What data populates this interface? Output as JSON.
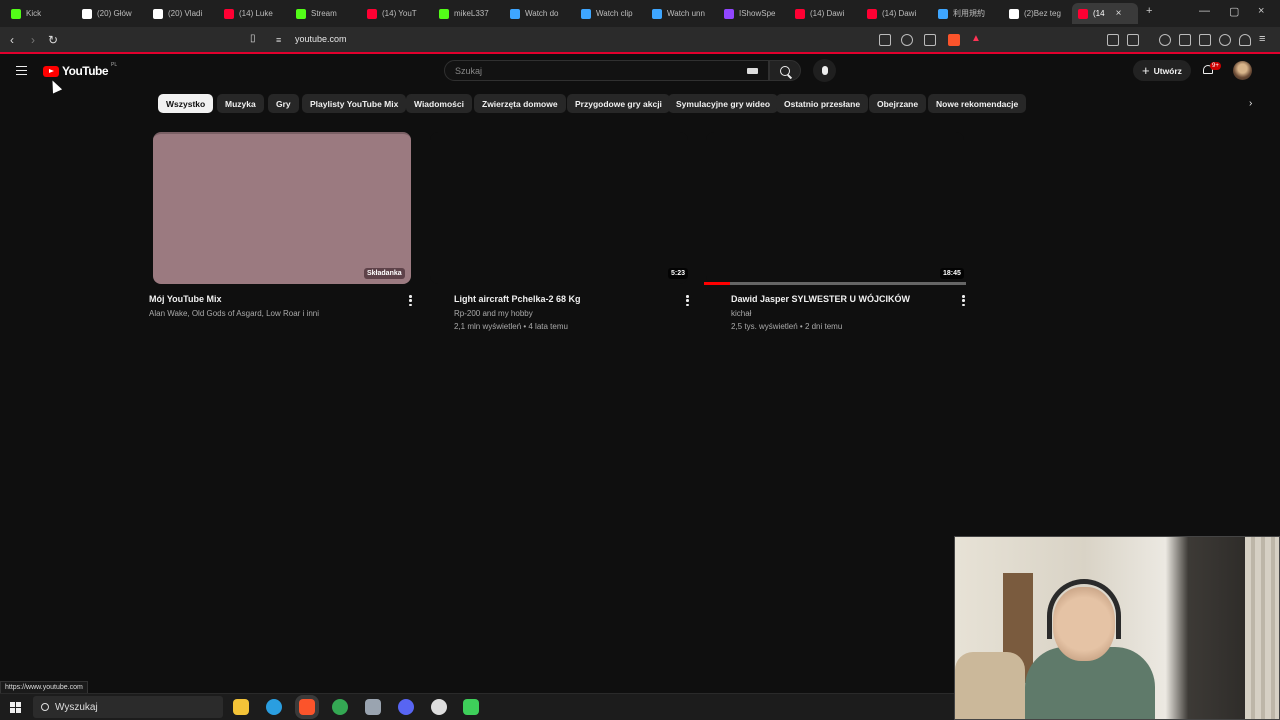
{
  "browser": {
    "tabs": [
      {
        "label": "Kick",
        "icon": "kick-icon",
        "color": "#53fc18"
      },
      {
        "label": "(20) Głów",
        "icon": "x-icon",
        "color": "#ffffff"
      },
      {
        "label": "(20) Vladi",
        "icon": "x-icon",
        "color": "#ffffff"
      },
      {
        "label": "(14) Luke",
        "icon": "youtube-icon",
        "color": "#ff0033"
      },
      {
        "label": "Stream",
        "icon": "kick-icon",
        "color": "#53fc18"
      },
      {
        "label": "(14) YouT",
        "icon": "youtube-icon",
        "color": "#ff0033"
      },
      {
        "label": "mikeL337",
        "icon": "kick-icon",
        "color": "#53fc18"
      },
      {
        "label": "Watch do",
        "icon": "globe-icon",
        "color": "#3ea6ff"
      },
      {
        "label": "Watch clip",
        "icon": "globe-icon",
        "color": "#3ea6ff"
      },
      {
        "label": "Watch unn",
        "icon": "globe-icon",
        "color": "#3ea6ff"
      },
      {
        "label": "IShowSpe",
        "icon": "twitch-icon",
        "color": "#9146ff"
      },
      {
        "label": "(14) Dawi",
        "icon": "youtube-icon",
        "color": "#ff0033"
      },
      {
        "label": "(14) Dawi",
        "icon": "youtube-icon",
        "color": "#ff0033"
      },
      {
        "label": "利用規約",
        "icon": "check-icon",
        "color": "#3ea6ff"
      },
      {
        "label": "(2)Bez teg",
        "icon": "tiktok-icon",
        "color": "#ffffff"
      },
      {
        "label": "(14",
        "icon": "youtube-icon",
        "color": "#ff0033",
        "active": true
      }
    ],
    "url": "youtube.com",
    "status_url": "https://www.youtube.com"
  },
  "header": {
    "logo_text": "YouTube",
    "logo_region": "PL",
    "search_placeholder": "Szukaj",
    "create_label": "Utwórz",
    "notification_count": "9+"
  },
  "chips": [
    {
      "label": "Wszystko",
      "selected": true
    },
    {
      "label": "Muzyka"
    },
    {
      "label": "Gry"
    },
    {
      "label": "Playlisty YouTube Mix"
    },
    {
      "label": "Wiadomości"
    },
    {
      "label": "Zwierzęta domowe"
    },
    {
      "label": "Przygodowe gry akcji"
    },
    {
      "label": "Symulacyjne gry wideo"
    },
    {
      "label": "Ostatnio przesłane"
    },
    {
      "label": "Obejrzane"
    },
    {
      "label": "Nowe rekomendacje"
    }
  ],
  "videos": [
    {
      "title": "Mój YouTube Mix",
      "channel": "Alan Wake, Old Gods of Asgard, Low Roar i inni",
      "stats": "",
      "badge": "Składanka",
      "thumb_color": "#9b7a80"
    },
    {
      "title": "Light aircraft Pchelka-2 68 Kg",
      "channel": "Rp-200 and my hobby",
      "stats": "2,1 mln wyświetleń • 4 lata temu",
      "duration": "5:23"
    },
    {
      "title": "Dawid Jasper SYLWESTER U WÓJCIKÓW",
      "channel": "kichał",
      "stats": "2,5 tys. wyświetleń • 2 dni temu",
      "duration": "18:45",
      "watched_fraction": 0.1
    }
  ],
  "taskbar": {
    "search_label": "Wyszukaj",
    "apps": [
      {
        "icon": "file-explorer-icon",
        "color": "#f3c338"
      },
      {
        "icon": "edge-icon",
        "color": "#2a9ee0"
      },
      {
        "icon": "brave-icon",
        "color": "#fb542b",
        "active": true
      },
      {
        "icon": "chrome-icon",
        "color": "#34a853"
      },
      {
        "icon": "app-icon",
        "color": "#9aa4b0"
      },
      {
        "icon": "discord-icon",
        "color": "#5865f2"
      },
      {
        "icon": "obs-icon",
        "color": "#dddddd"
      },
      {
        "icon": "app-green-icon",
        "color": "#3ecf5a"
      }
    ]
  }
}
